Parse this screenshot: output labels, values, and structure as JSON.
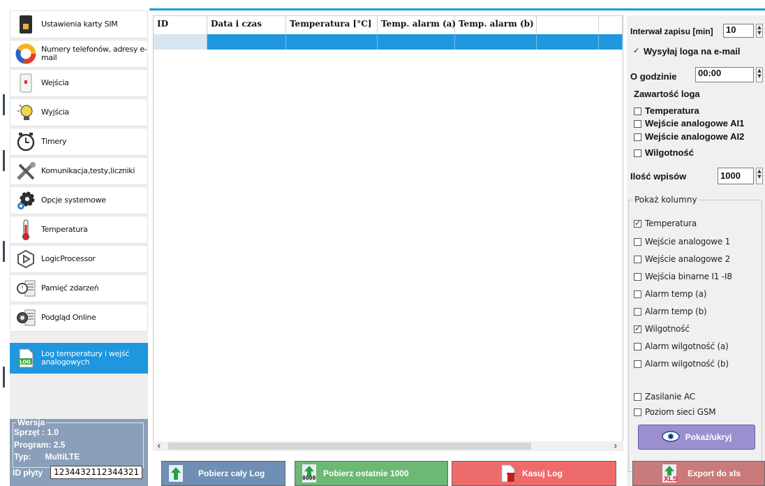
{
  "sidebar": {
    "items": [
      {
        "label": "Ustawienia karty SIM",
        "icon": "sim-card-icon"
      },
      {
        "label": "Numery telefonów, adresy e-mail",
        "icon": "contacts-ring-icon"
      },
      {
        "label": "Wejścia",
        "icon": "input-sensor-icon"
      },
      {
        "label": "Wyjścia",
        "icon": "lightbulb-icon"
      },
      {
        "label": "Timery",
        "icon": "alarm-clock-icon"
      },
      {
        "label": "Komunikacja,testy,liczniki",
        "icon": "tools-icon"
      },
      {
        "label": "Opcje systemowe",
        "icon": "gears-icon"
      },
      {
        "label": "Temperatura",
        "icon": "thermometer-icon"
      },
      {
        "label": "LogicProcessor",
        "icon": "logic-processor-icon"
      },
      {
        "label": "Pamięć zdarzeń",
        "icon": "event-memory-icon"
      },
      {
        "label": "Podgląd Online",
        "icon": "online-preview-icon"
      },
      {
        "label": "Log temperatury i wejść analogowych",
        "icon": "log-icon",
        "active": true
      }
    ]
  },
  "version": {
    "legend": "Wersja",
    "hw_label": "Sprzęt :",
    "hw_value": "1.0",
    "prog_label": "Program:",
    "prog_value": "2.5",
    "type_label": "Typ:",
    "type_value": "MultiLTE",
    "id_label": "ID płyty",
    "id_value": "1234432112344321"
  },
  "table": {
    "columns": [
      "ID",
      "Data i czas",
      "Temperatura [°C]",
      "Temp. alarm (a)",
      "Temp. alarm (b)",
      "",
      ""
    ],
    "rows": 1
  },
  "right_panel": {
    "interval_label": "Interwał zapisu [min]",
    "interval_value": "10",
    "send_email_label": "Wysyłaj loga na e-mail",
    "send_email_checked": true,
    "at_hour_label": "O godzinie",
    "at_hour_value": "00:00",
    "content_label": "Zawartość loga",
    "content_options": [
      {
        "label": "Temperatura",
        "checked": false
      },
      {
        "label": "Wejście analogowe AI1",
        "checked": false
      },
      {
        "label": "Wejście analogowe AI2",
        "checked": false
      },
      {
        "label": "Wilgotność",
        "checked": false
      }
    ],
    "entries_label": "Ilość wpisów",
    "entries_value": "1000",
    "show_columns_legend": "Pokaż kolumny",
    "show_columns": [
      {
        "label": "Temperatura",
        "checked": true
      },
      {
        "label": "Wejście analogowe 1",
        "checked": false
      },
      {
        "label": "Wejście analogowe 2",
        "checked": false
      },
      {
        "label": "Wejścia binarne I1 -I8",
        "checked": false
      },
      {
        "label": "Alarm temp (a)",
        "checked": false
      },
      {
        "label": "Alarm temp (b)",
        "checked": false
      },
      {
        "label": "Wilgotność",
        "checked": true
      },
      {
        "label": "Alarm wilgotność (a)",
        "checked": false
      },
      {
        "label": "Alarm wilgotność (b)",
        "checked": false
      },
      {
        "label": "Zasilanie AC",
        "checked": false
      },
      {
        "label": "Poziom sieci GSM",
        "checked": false
      }
    ],
    "show_hide_label": "Pokaż/ukryj"
  },
  "bottom_buttons": {
    "download_all": "Pobierz cały Log",
    "download_last": "Pobierz ostatnie 1000",
    "download_last_badge": "0000",
    "delete_log": "Kasuj Log",
    "export_xls": "Export do xls",
    "export_badge": "XLS"
  },
  "colors": {
    "accent": "#1e97de",
    "version_bg": "#8a9fb8",
    "btn_download_all": "#6f8fb4",
    "btn_download_last": "#6cb874",
    "btn_delete": "#ee6b6b",
    "btn_export": "#c97a7a",
    "btn_show_hide": "#9b8fd0"
  }
}
